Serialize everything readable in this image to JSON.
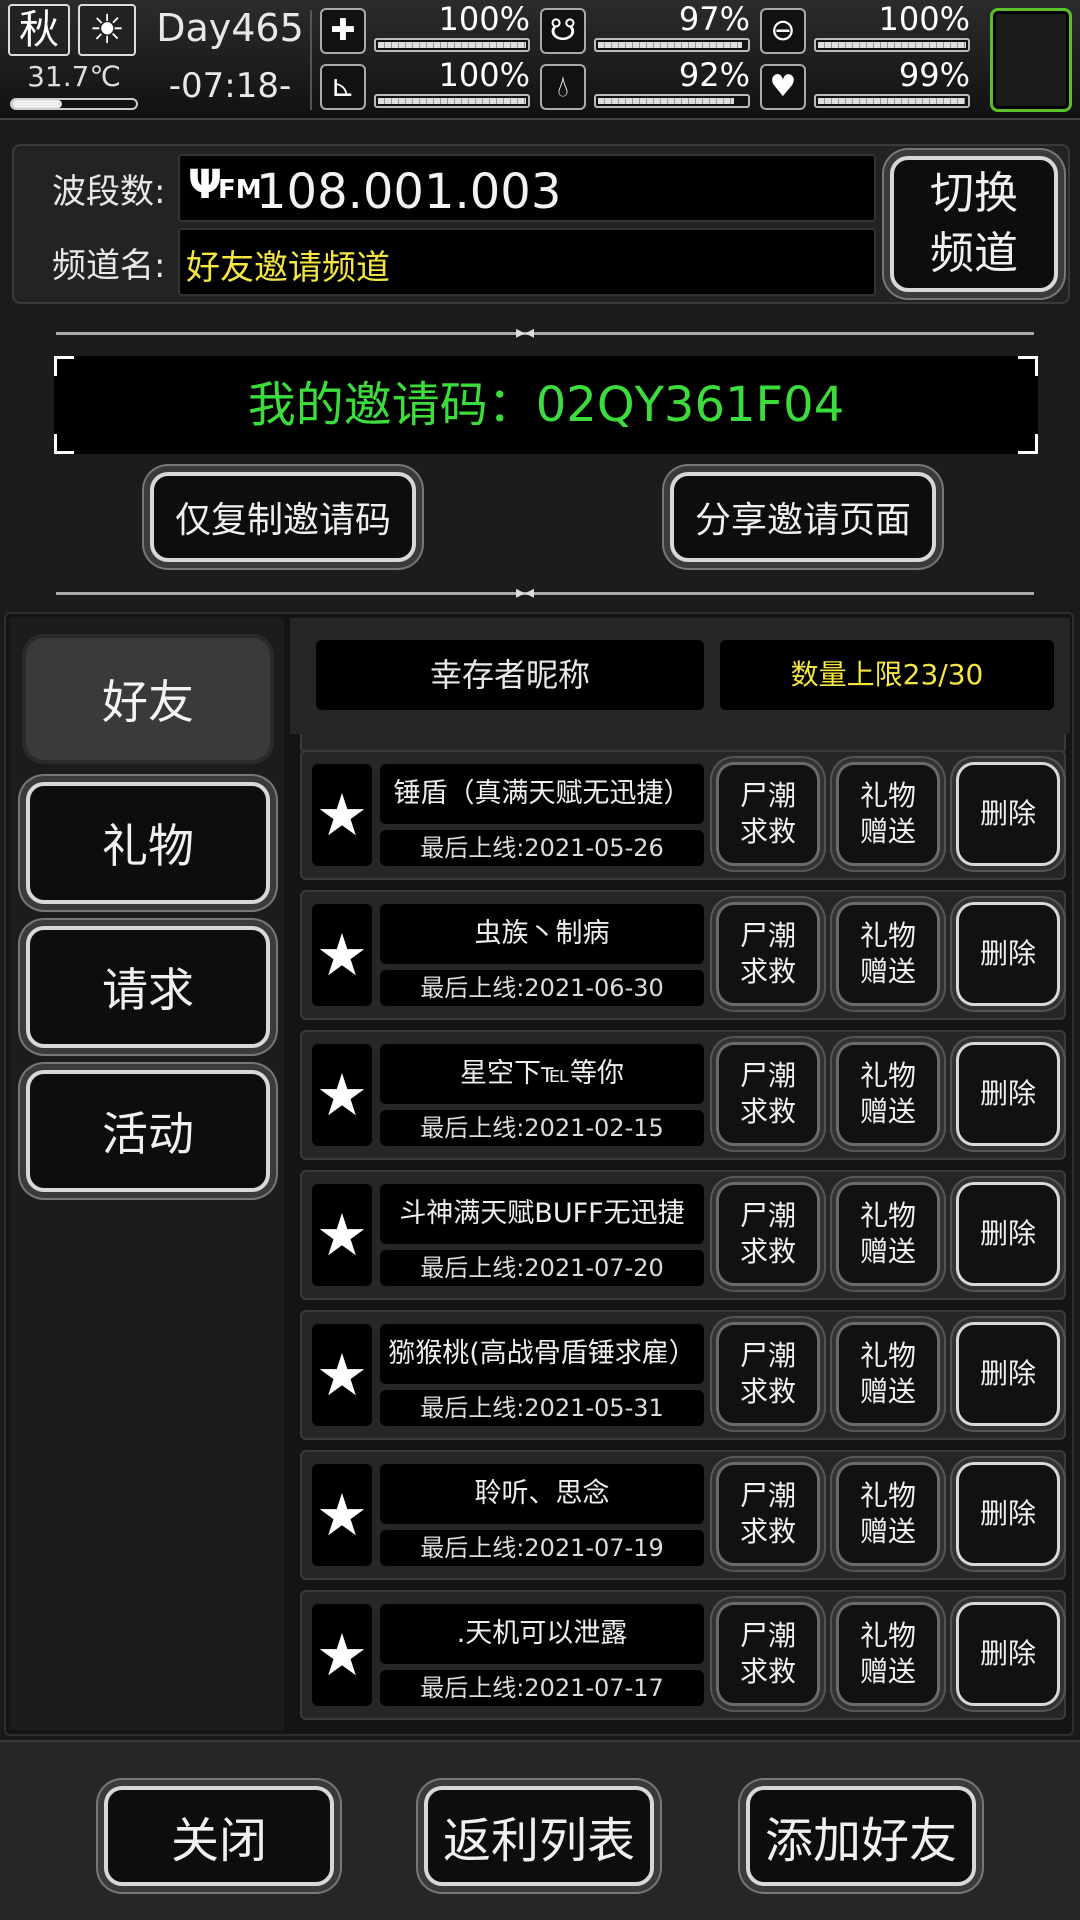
{
  "status": {
    "season": "秋",
    "weather_icon": "sun-icon",
    "temperature": "31.7℃",
    "day": "Day465",
    "time": "-07:18-",
    "stats": [
      {
        "name": "health",
        "icon": "medkit-icon",
        "value": "100%",
        "level": 1.0
      },
      {
        "name": "hunger",
        "icon": "stomach-icon",
        "value": "97%",
        "level": 0.97
      },
      {
        "name": "sanity",
        "icon": "pill-icon",
        "value": "100%",
        "level": 1.0
      },
      {
        "name": "stamina",
        "icon": "boot-icon",
        "value": "100%",
        "level": 1.0
      },
      {
        "name": "thirst",
        "icon": "water-drop-icon",
        "value": "92%",
        "level": 0.92
      },
      {
        "name": "mood",
        "icon": "heart-icon",
        "value": "99%",
        "level": 0.99
      }
    ]
  },
  "radio": {
    "band_label": "波段数:",
    "band_icon_text": "FM",
    "band_value": "108.001.003",
    "channel_label": "频道名:",
    "channel_value": "好友邀请频道",
    "switch_button": "切换\n频道"
  },
  "invite": {
    "code_label": "我的邀请码：02QY361F04",
    "copy_button": "仅复制邀请码",
    "share_button": "分享邀请页面"
  },
  "sidebar": {
    "tabs": [
      {
        "label": "好友",
        "active": true
      },
      {
        "label": "礼物",
        "active": false
      },
      {
        "label": "请求",
        "active": false
      },
      {
        "label": "活动",
        "active": false
      }
    ]
  },
  "list_header": {
    "name_col": "幸存者昵称",
    "limit": "数量上限23/30"
  },
  "friends": [
    {
      "name": "锤盾（真满天赋无迅捷）",
      "last_login": "最后上线:2021-05-26"
    },
    {
      "name": "虫族丶制病",
      "last_login": "最后上线:2021-06-30"
    },
    {
      "name": "星空下℡等你",
      "last_login": "最后上线:2021-02-15"
    },
    {
      "name": "斗神满天赋BUFF无迅捷",
      "last_login": "最后上线:2021-07-20"
    },
    {
      "name": "猕猴桃(高战骨盾锤求雇）",
      "last_login": "最后上线:2021-05-31"
    },
    {
      "name": "聆听、思念",
      "last_login": "最后上线:2021-07-19"
    },
    {
      "name": ".天机可以泄露",
      "last_login": "最后上线:2021-07-17"
    }
  ],
  "row_buttons": {
    "rescue": "尸潮\n求救",
    "gift": "礼物\n赠送",
    "delete": "删除"
  },
  "bottom": {
    "close": "关闭",
    "rebate": "返利列表",
    "add_friend": "添加好友"
  },
  "colors": {
    "invite_code": "#3ddc3d",
    "channel_name": "#f5e642",
    "limit_text": "#f5e642",
    "avatar_border": "#5bbf2a"
  }
}
